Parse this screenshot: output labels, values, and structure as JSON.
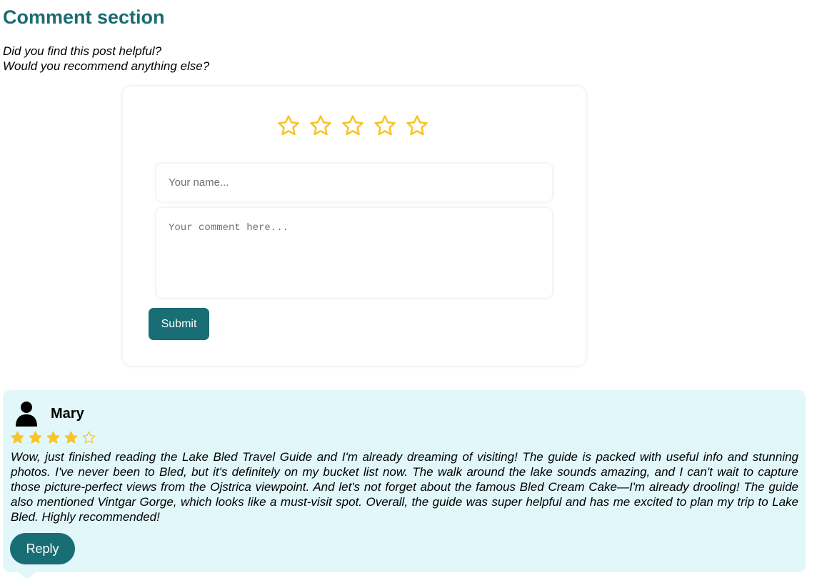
{
  "section": {
    "title": "Comment section",
    "prompt_line1": "Did you find this post helpful?",
    "prompt_line2": "Would you recommend anything else?"
  },
  "form": {
    "rating_max": 5,
    "rating_value": 0,
    "name_placeholder": "Your name...",
    "name_value": "",
    "comment_placeholder": "Your comment here...",
    "comment_value": "",
    "submit_label": "Submit"
  },
  "comments": [
    {
      "author": "Mary",
      "avatar_icon": "user-icon",
      "rating": 4,
      "rating_max": 5,
      "text": "Wow, just finished reading the Lake Bled Travel Guide and I'm already dreaming of visiting! The guide is packed with useful info and stunning photos. I've never been to Bled, but it's definitely on my bucket list now. The walk around the lake sounds amazing, and I can't wait to capture those picture-perfect views from the Ojstrica viewpoint. And let's not forget about the famous Bled Cream Cake—I'm already drooling! The guide also mentioned Vintgar Gorge, which looks like a must-visit spot. Overall, the guide was super helpful and has me excited to plan my trip to Lake Bled. Highly recommended!",
      "reply_label": "Reply"
    }
  ],
  "colors": {
    "accent": "#196d75",
    "title": "#1a6b72",
    "star": "#f7c42a",
    "comment_bg": "#e1f7fa"
  }
}
